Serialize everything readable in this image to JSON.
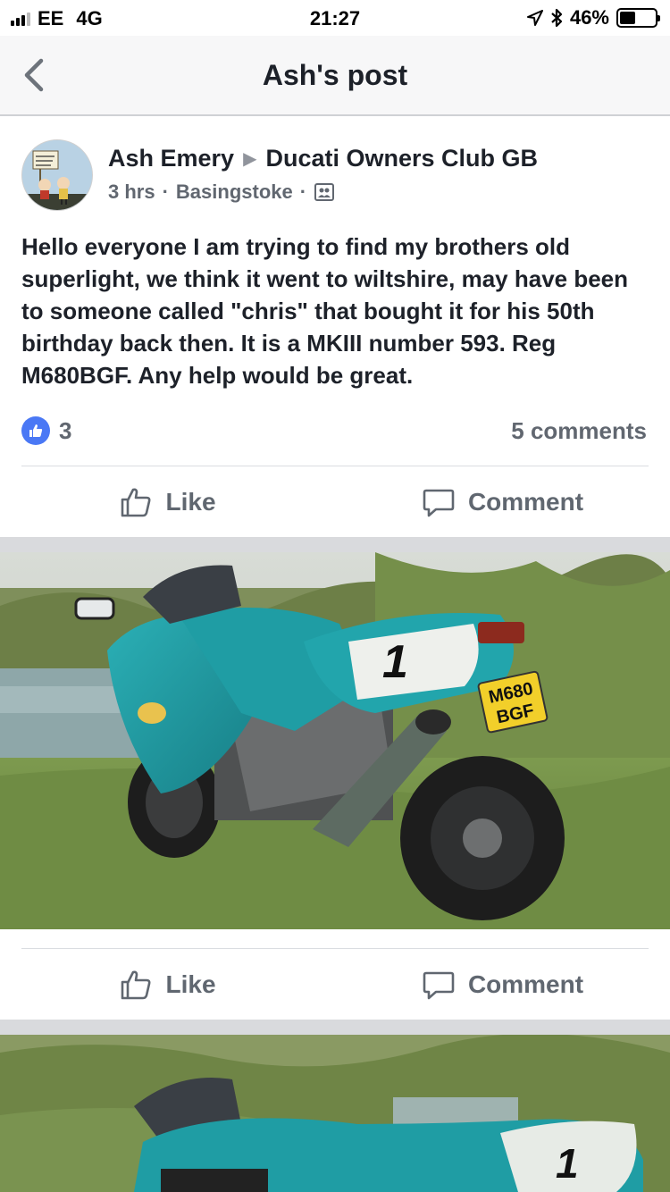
{
  "status_bar": {
    "carrier": "EE",
    "network": "4G",
    "time": "21:27",
    "battery": "46%",
    "battery_level": 0.46
  },
  "nav": {
    "title": "Ash's post"
  },
  "post": {
    "author": "Ash Emery",
    "group": "Ducati Owners Club GB",
    "time": "3 hrs",
    "location": "Basingstoke",
    "text": "Hello everyone I am trying to find my brothers old superlight, we think it went to wiltshire, may have been to someone called \"chris\" that bought it for his 50th birthday back then. It is a MKIII number 593. Reg M680BGF. Any help would be great.",
    "like_count": "3",
    "comments": "5 comments",
    "like_label": "Like",
    "comment_label": "Comment"
  },
  "photo1": {
    "number_panel": "1",
    "plate_line1": "M680",
    "plate_line2": "BGF",
    "like_label": "Like",
    "comment_label": "Comment"
  },
  "photo2": {
    "number_panel": "1"
  },
  "colors": {
    "accent": "#4a78f5",
    "bike_teal": "#1e9aa3",
    "separator": "#d9dadd"
  }
}
